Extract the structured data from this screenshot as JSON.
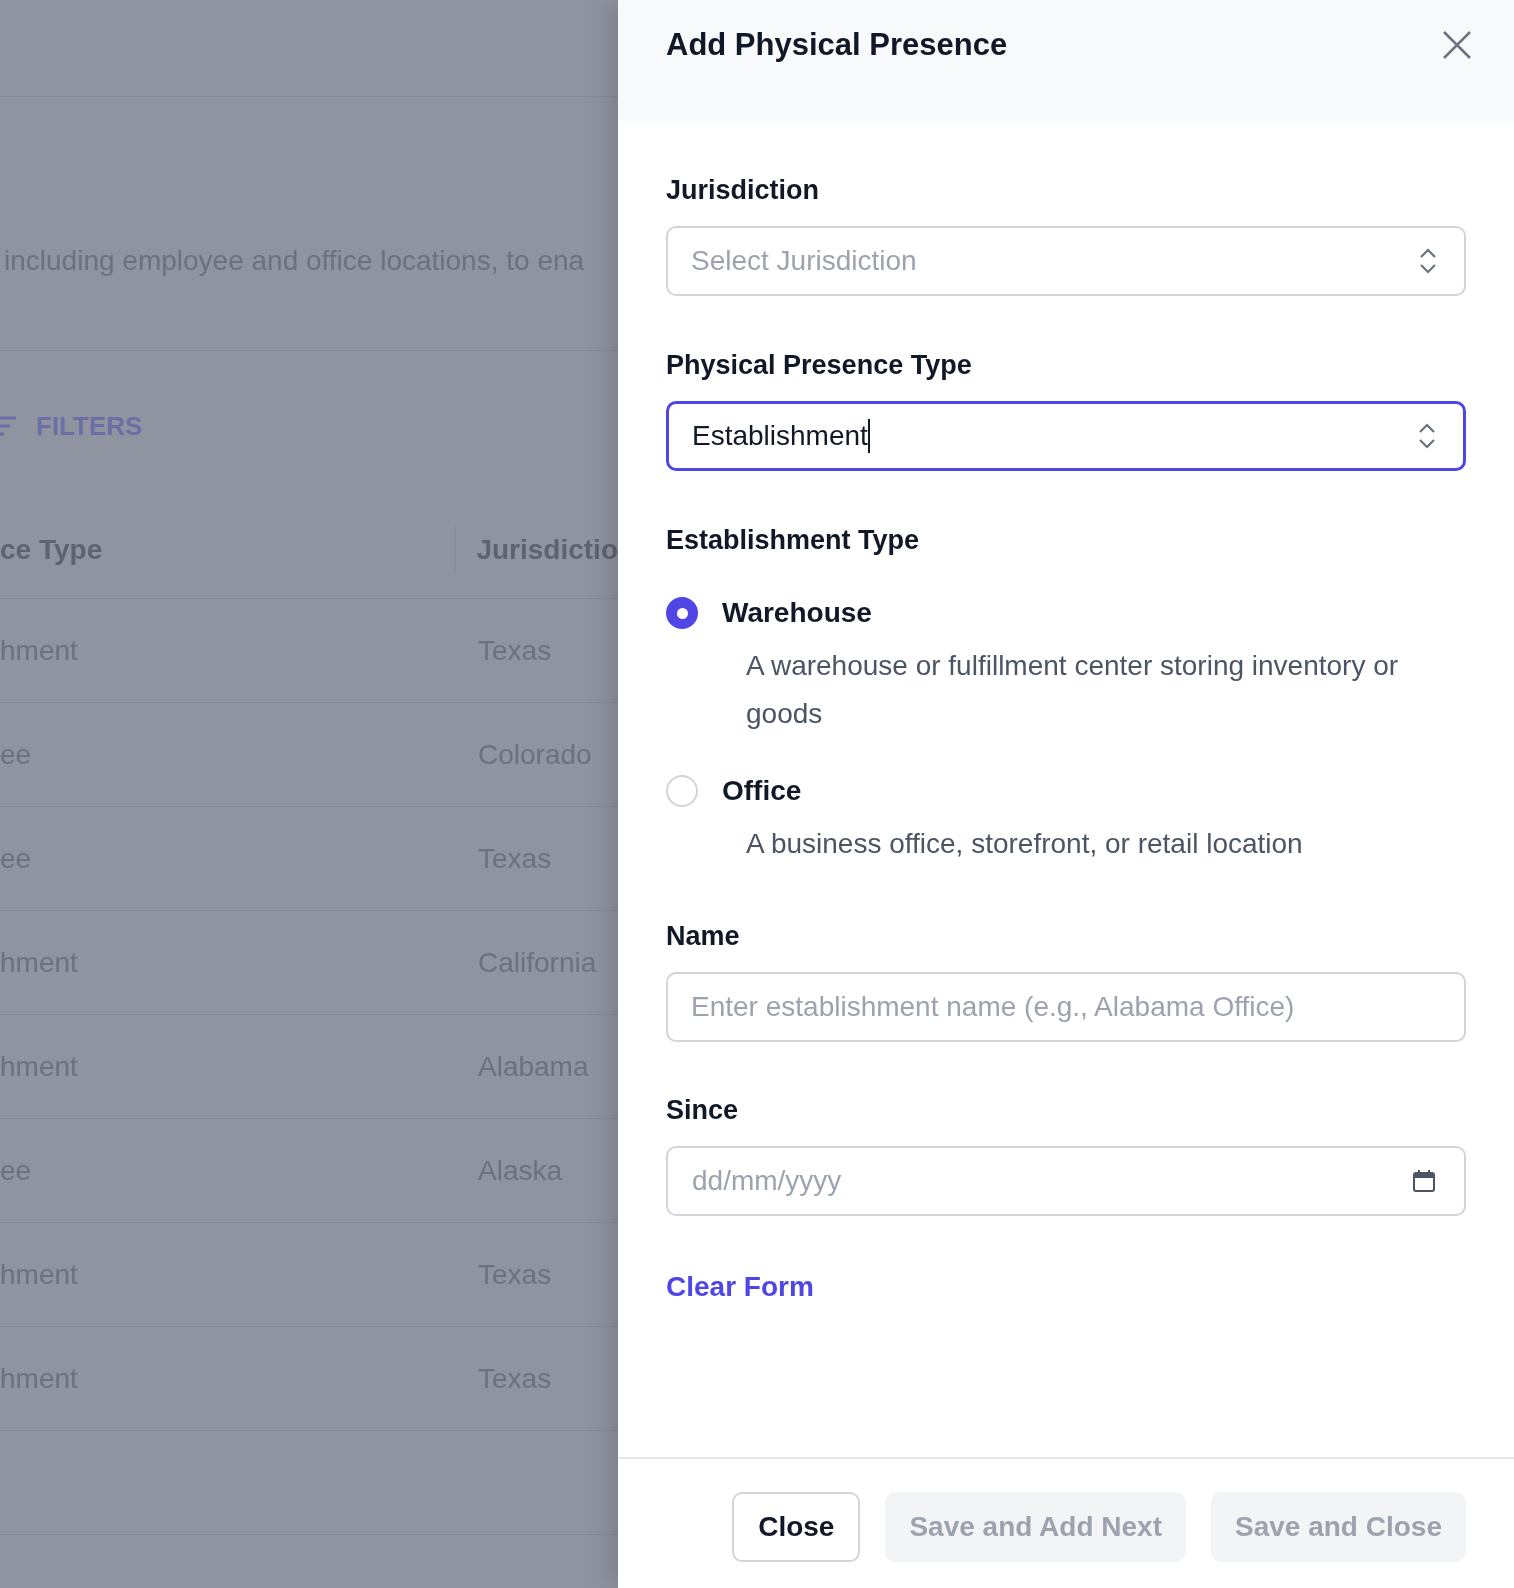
{
  "background_page": {
    "description": "including employee and office locations, to ena",
    "filters_button": "FILTERS",
    "table": {
      "columns": [
        "ce Type",
        "Jurisdictio"
      ],
      "rows": [
        [
          "hment",
          "Texas"
        ],
        [
          "ee",
          "Colorado"
        ],
        [
          "ee",
          "Texas"
        ],
        [
          "hment",
          "California"
        ],
        [
          "hment",
          "Alabama"
        ],
        [
          "ee",
          "Alaska"
        ],
        [
          "hment",
          "Texas"
        ],
        [
          "hment",
          "Texas"
        ]
      ]
    }
  },
  "panel": {
    "title": "Add Physical Presence",
    "jurisdiction": {
      "label": "Jurisdiction",
      "placeholder": "Select Jurisdiction",
      "focused": false
    },
    "presence_type": {
      "label": "Physical Presence Type",
      "value": "Establishment",
      "focused": true
    },
    "establishment_type": {
      "label": "Establishment Type",
      "options": [
        {
          "label": "Warehouse",
          "description": "A warehouse or fulfillment center storing inventory or goods",
          "selected": true
        },
        {
          "label": "Office",
          "description": "A business office, storefront, or retail location",
          "selected": false
        }
      ]
    },
    "name": {
      "label": "Name",
      "placeholder": "Enter establishment name (e.g., Alabama Office)"
    },
    "since": {
      "label": "Since",
      "placeholder": "dd/mm/yyyy"
    },
    "clear_form": "Clear Form",
    "buttons": [
      {
        "label": "Close",
        "disabled": false
      },
      {
        "label": "Save and Add Next",
        "disabled": true
      },
      {
        "label": "Save and Close",
        "disabled": true
      }
    ]
  }
}
